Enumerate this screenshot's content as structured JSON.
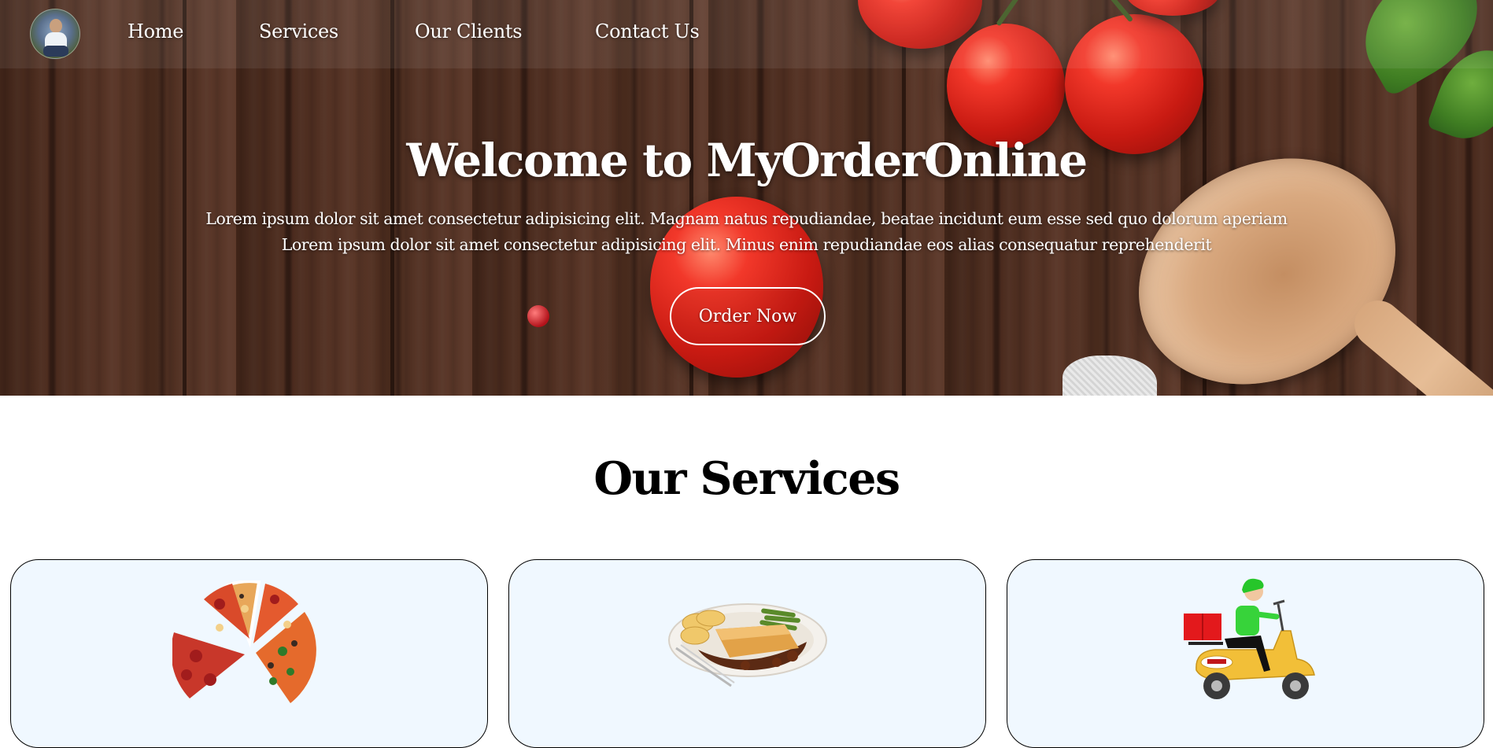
{
  "nav": {
    "avatar_alt": "profile photo",
    "links": [
      "Home",
      "Services",
      "Our Clients",
      "Contact Us"
    ]
  },
  "hero": {
    "title": "Welcome to MyOrderOnline",
    "line1": "Lorem ipsum dolor sit amet consectetur adipisicing elit. Magnam natus repudiandae, beatae incidunt eum esse sed quo dolorum aperiam",
    "line2": "Lorem ipsum dolor sit amet consectetur adipisicing elit. Minus enim repudiandae eos alias consequatur reprehenderit",
    "button": "Order Now"
  },
  "services": {
    "title": "Our Services",
    "cards": [
      {
        "image": "pizza-slices-image"
      },
      {
        "image": "meat-pie-dinner-image"
      },
      {
        "image": "delivery-scooter-image"
      }
    ]
  },
  "colors": {
    "card_bg": "#f0f8ff",
    "text_light": "#ffffff",
    "text_dark": "#000000"
  }
}
